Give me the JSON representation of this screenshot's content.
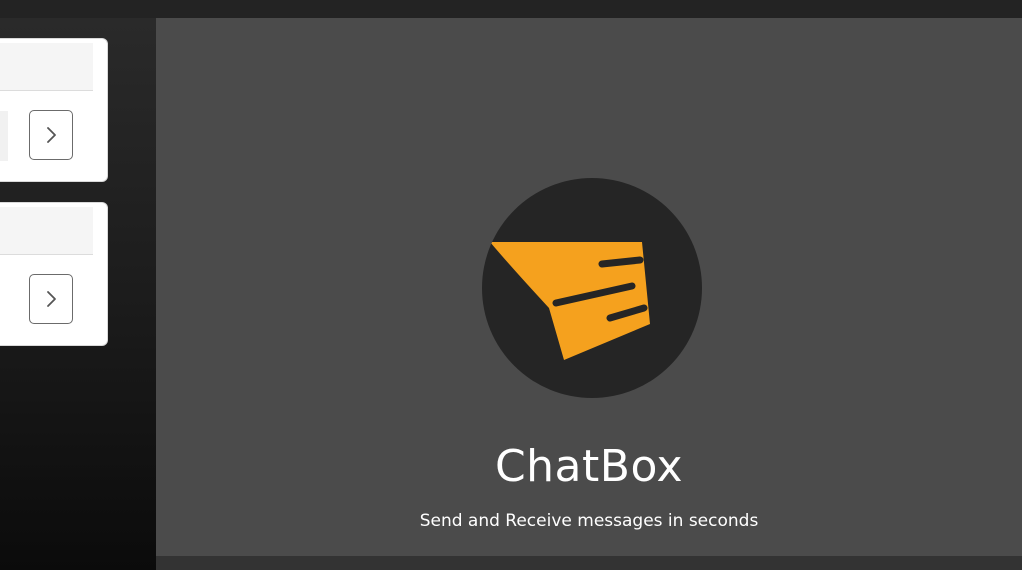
{
  "app": {
    "title": "ChatBox",
    "tagline": "Send and Receive messages in seconds"
  },
  "cards": [
    {
      "button_icon": "chevron-right-icon"
    },
    {
      "button_icon": "chevron-right-icon"
    }
  ],
  "logo": {
    "icon": "paper-plane-message-icon",
    "circle_color": "#252525",
    "accent_color": "#F5A11E"
  },
  "colors": {
    "panel_bg": "#4B4B4B",
    "page_bg": "#222222",
    "text": "#FFFFFF"
  }
}
